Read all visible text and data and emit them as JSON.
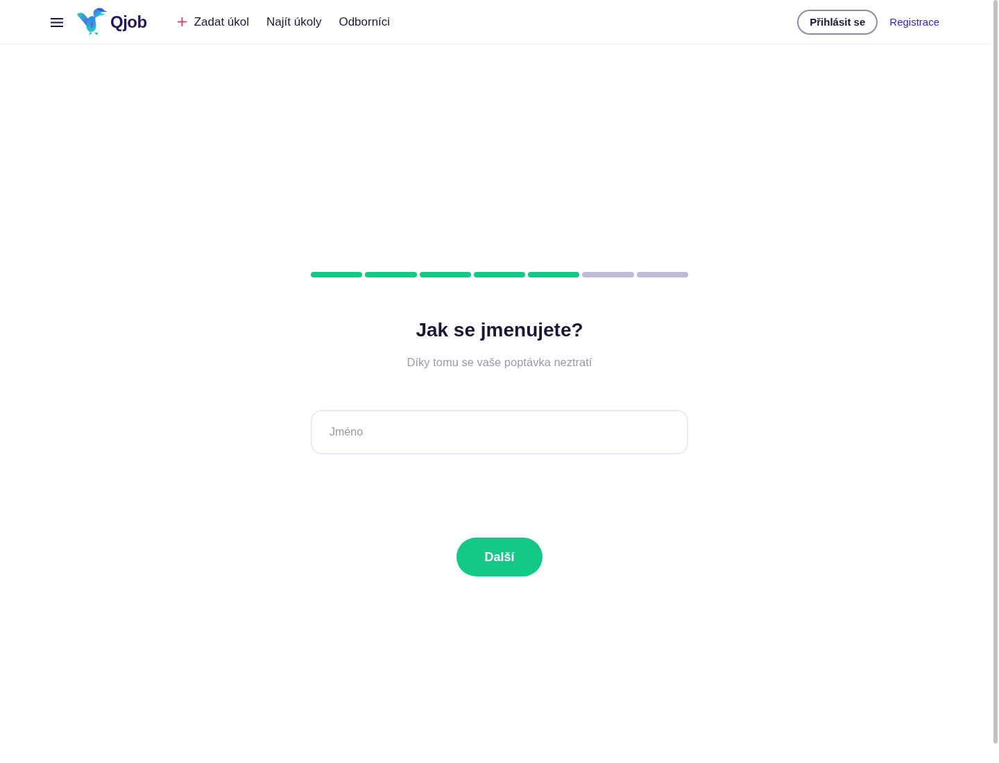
{
  "header": {
    "logo": {
      "text": "Qjob"
    },
    "nav": [
      {
        "label": "Zadat úkol",
        "kind": "add"
      },
      {
        "label": "Najít úkoly",
        "kind": "plain"
      },
      {
        "label": "Odborníci",
        "kind": "plain"
      }
    ],
    "login_button": "Přihlásit se",
    "register_link": "Registrace"
  },
  "progress": {
    "steps": [
      {
        "done": true
      },
      {
        "done": true
      },
      {
        "done": true
      },
      {
        "done": true
      },
      {
        "done": true
      },
      {
        "done": false
      },
      {
        "done": false
      }
    ]
  },
  "heading": "Jak se jmenujete?",
  "subtitle": "Díky tomu se vaše poptávka neztratí",
  "name_field": {
    "placeholder": "Jméno"
  },
  "next_button": "Další"
}
